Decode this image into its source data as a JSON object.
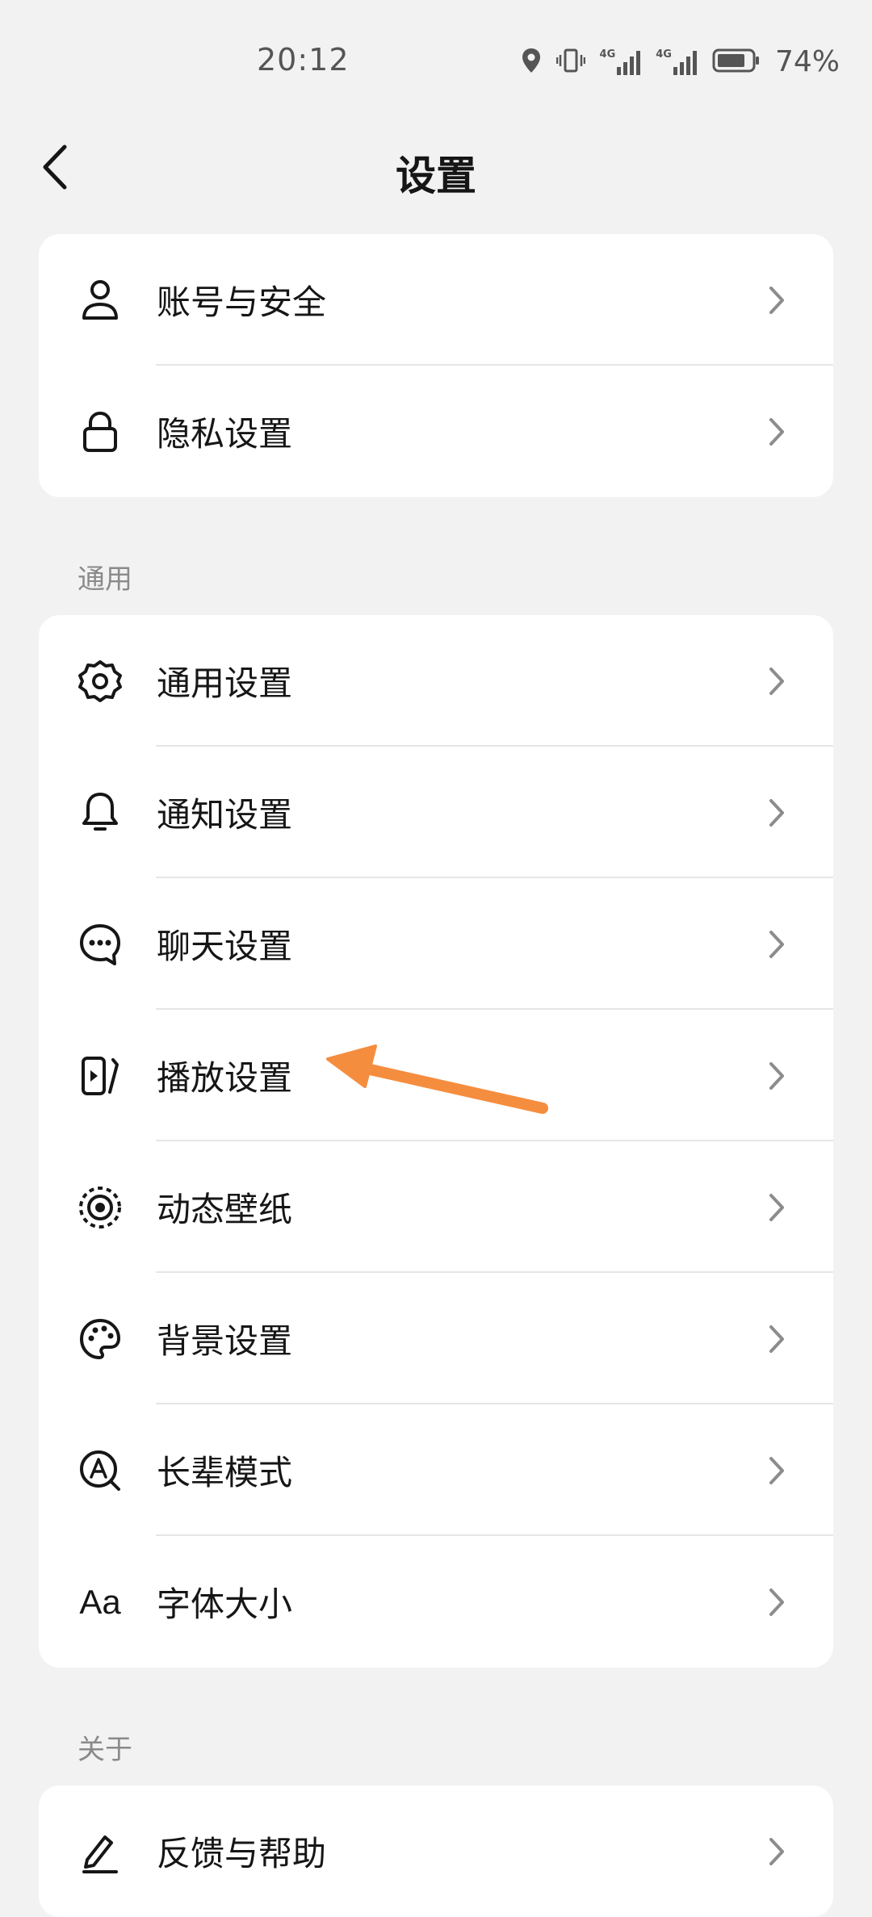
{
  "status_bar": {
    "time": "20:12",
    "network_1": "4G",
    "network_2": "4G",
    "battery_percent": "74%"
  },
  "header": {
    "title": "设置"
  },
  "group_account": {
    "items": [
      {
        "label": "账号与安全",
        "icon": "person-icon"
      },
      {
        "label": "隐私设置",
        "icon": "lock-icon"
      }
    ]
  },
  "section_general": {
    "title": "通用",
    "items": [
      {
        "label": "通用设置",
        "icon": "gear-icon"
      },
      {
        "label": "通知设置",
        "icon": "bell-icon"
      },
      {
        "label": "聊天设置",
        "icon": "chat-bubble-icon"
      },
      {
        "label": "播放设置",
        "icon": "play-screen-icon"
      },
      {
        "label": "动态壁纸",
        "icon": "dynamic-wallpaper-icon"
      },
      {
        "label": "背景设置",
        "icon": "palette-icon"
      },
      {
        "label": "长辈模式",
        "icon": "elder-mode-icon"
      },
      {
        "label": "字体大小",
        "icon": "font-size-icon",
        "icon_text": "Aa"
      }
    ]
  },
  "section_about": {
    "title": "关于",
    "items": [
      {
        "label": "反馈与帮助",
        "icon": "pencil-icon"
      }
    ]
  },
  "colors": {
    "background": "#f2f2f2",
    "card": "#ffffff",
    "text": "#161616",
    "section_label": "#8a8a8a",
    "chevron": "#8c8c8c",
    "annotation_arrow": "#f58d3f"
  }
}
